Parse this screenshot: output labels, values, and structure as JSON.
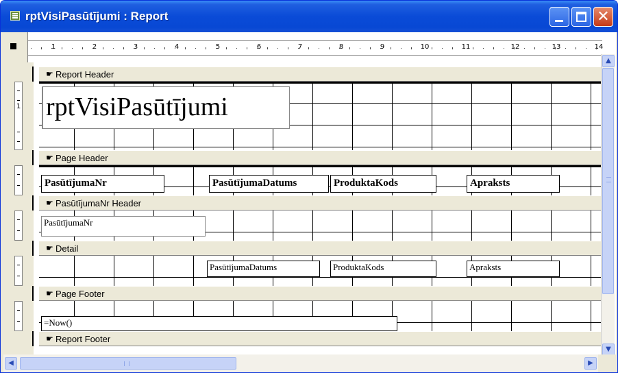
{
  "window": {
    "title": "rptVisiPasūtījumi : Report",
    "controls": {
      "minimize": "minimize",
      "maximize": "maximize",
      "close": "✕"
    }
  },
  "ruler": {
    "numbers": [
      "1",
      "2",
      "3",
      "4",
      "5",
      "6",
      "7",
      "8",
      "9",
      "10",
      "11",
      "12",
      "13",
      "14"
    ],
    "vertical_numbers": [
      "1"
    ]
  },
  "sections": {
    "report_header": "Report Header",
    "page_header": "Page Header",
    "group_header": "PasūtījumaNr Header",
    "detail": "Detail",
    "page_footer": "Page Footer",
    "report_footer": "Report Footer"
  },
  "controls": {
    "report_title": "rptVisiPasūtījumi",
    "page_header_labels": [
      "PasūtījumaNr",
      "PasūtījumaDatums",
      "ProduktaKods",
      "Apraksts"
    ],
    "group_field": "PasūtījumaNr",
    "detail_fields": [
      "PasūtījumaDatums",
      "ProduktaKods",
      "Apraksts"
    ],
    "footer_expression": "=Now()"
  },
  "icons": {
    "app": "report-icon",
    "section_marker": "pointing-hand-icon",
    "scroll_up": "arrow-up-icon",
    "scroll_down": "arrow-down-icon",
    "scroll_left": "arrow-left-icon",
    "scroll_right": "arrow-right-icon"
  },
  "colors": {
    "titlebar": "#0A4BD7",
    "window_chrome": "#ECE9D8",
    "close_button": "#C73B16",
    "scroll_thumb": "#C6D3F7"
  }
}
